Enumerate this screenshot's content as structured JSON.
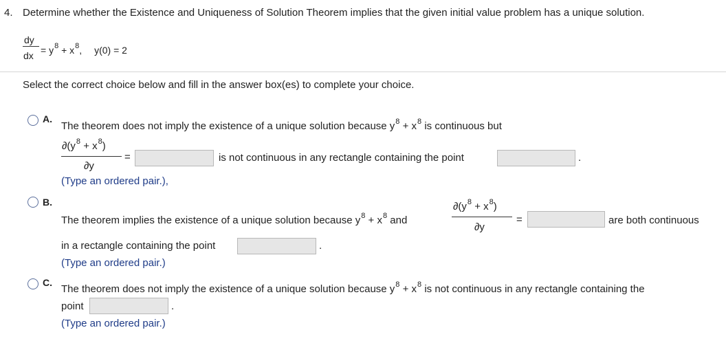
{
  "question": {
    "number": "4.",
    "prompt": "Determine whether the Existence and Uniqueness of Solution Theorem implies that the given initial value problem has a unique solution.",
    "equation": {
      "numerator": "dy",
      "denominator": "dx",
      "eq": "=",
      "y": "y",
      "exp": "8",
      "plus": "+",
      "x": "x",
      "trail": ",",
      "initial": "y(0) = 2"
    }
  },
  "instruction": "Select the correct choice below and fill in the answer box(es) to complete your choice.",
  "options": {
    "a": {
      "letter": "A.",
      "text1": "The theorem does not imply the existence of a unique solution because y",
      "text1b": " + x",
      "text1c": " is continuous but",
      "partial_num_a": "∂(y",
      "partial_num_b": " + x",
      "partial_num_c": ")",
      "partial_den": "∂y",
      "eq": "=",
      "text2": "is not continuous in any rectangle containing the point",
      "period": ".",
      "hint": "(Type an ordered pair.),"
    },
    "b": {
      "letter": "B.",
      "text1": "The theorem implies the existence of a unique solution because y",
      "text1b": " + x",
      "text1c": " and",
      "partial_num_a": "∂(y",
      "partial_num_b": " + x",
      "partial_num_c": ")",
      "partial_den": "∂y",
      "eq": "=",
      "text2": "are both continuous",
      "text3": "in a rectangle containing the point",
      "period": ".",
      "hint": "(Type an ordered pair.)"
    },
    "c": {
      "letter": "C.",
      "text1": "The theorem does not imply the existence of a unique solution because y",
      "text1b": " + x",
      "text1c": " is not continuous in any rectangle containing the",
      "text2": "point",
      "period": ".",
      "hint": "(Type an ordered pair.)"
    }
  },
  "exp": "8"
}
